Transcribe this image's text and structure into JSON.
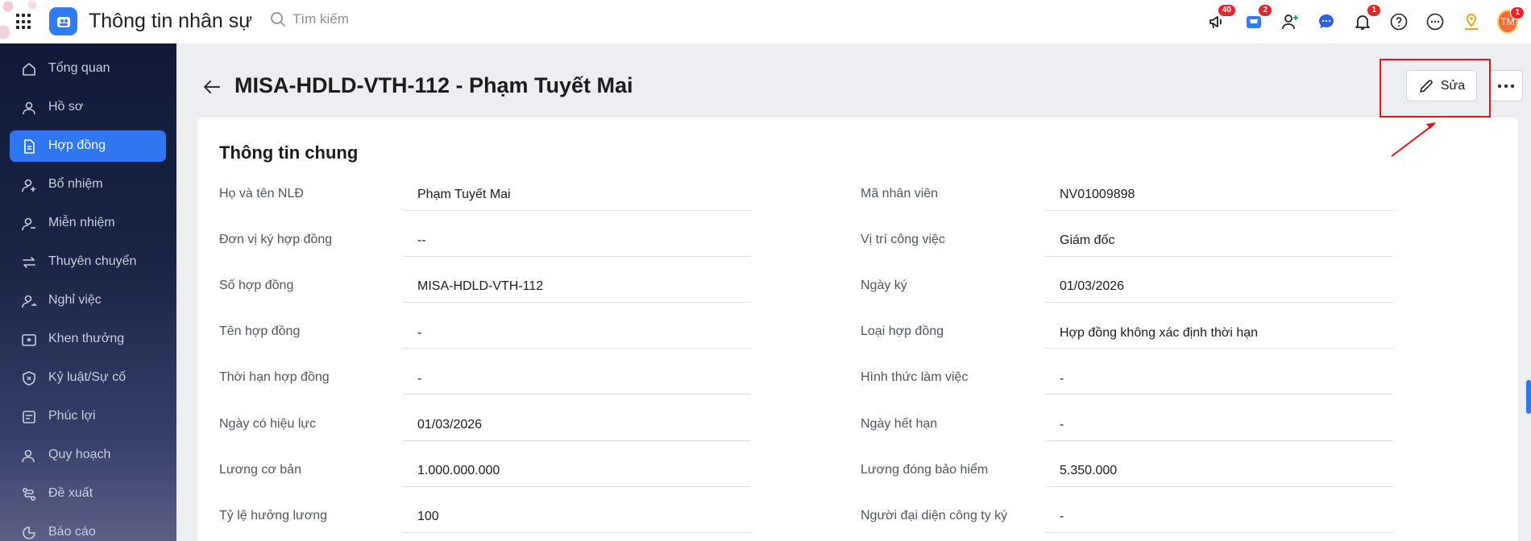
{
  "app": {
    "title": "Thông tin nhân sự"
  },
  "search": {
    "placeholder": "Tìm kiếm"
  },
  "topbar": {
    "badges": {
      "megaphone": "40",
      "cart": "2",
      "bell": "1",
      "avatar": "1"
    },
    "avatar_initials": "TM"
  },
  "sidebar": {
    "items": [
      {
        "label": "Tổng quan",
        "icon": "home-icon"
      },
      {
        "label": "Hồ sơ",
        "icon": "user-icon"
      },
      {
        "label": "Hợp đồng",
        "icon": "document-icon",
        "active": true
      },
      {
        "label": "Bổ nhiệm",
        "icon": "user-plus-icon"
      },
      {
        "label": "Miễn nhiệm",
        "icon": "user-minus-icon"
      },
      {
        "label": "Thuyên chuyển",
        "icon": "transfer-icon"
      },
      {
        "label": "Nghỉ việc",
        "icon": "user-leave-icon"
      },
      {
        "label": "Khen thưởng",
        "icon": "award-icon"
      },
      {
        "label": "Kỷ luật/Sự cố",
        "icon": "shield-icon"
      },
      {
        "label": "Phúc lợi",
        "icon": "benefit-icon"
      },
      {
        "label": "Quy hoạch",
        "icon": "planning-icon"
      },
      {
        "label": "Đề xuất",
        "icon": "proposal-icon"
      },
      {
        "label": "Báo cáo",
        "icon": "report-icon"
      }
    ]
  },
  "header": {
    "title": "MISA-HDLD-VTH-112 - Phạm Tuyết Mai",
    "edit_label": "Sửa"
  },
  "section": {
    "title": "Thông tin chung",
    "fields": [
      {
        "label": "Họ và tên NLĐ",
        "value": "Phạm Tuyết Mai"
      },
      {
        "label": "Mã nhân viên",
        "value": "NV01009898"
      },
      {
        "label": "Đơn vị ký hợp đồng",
        "value": "--"
      },
      {
        "label": "Vị trí công việc",
        "value": "Giám đốc"
      },
      {
        "label": "Số hợp đồng",
        "value": "MISA-HDLD-VTH-112"
      },
      {
        "label": "Ngày ký",
        "value": "01/03/2026"
      },
      {
        "label": "Tên hợp đồng",
        "value": "-"
      },
      {
        "label": "Loại hợp đồng",
        "value": "Hợp đồng không xác định thời hạn"
      },
      {
        "label": "Thời hạn hợp đồng",
        "value": "-"
      },
      {
        "label": "Hình thức làm việc",
        "value": "-"
      },
      {
        "label": "Ngày có hiệu lực",
        "value": "01/03/2026"
      },
      {
        "label": "Ngày hết hạn",
        "value": "-"
      },
      {
        "label": "Lương cơ bản",
        "value": "1.000.000.000"
      },
      {
        "label": "Lương đóng bảo hiểm",
        "value": "5.350.000"
      },
      {
        "label": "Tỷ lệ hưởng lương",
        "value": "100"
      },
      {
        "label": "Người đại diện công ty ký",
        "value": "-"
      }
    ]
  },
  "colors": {
    "accent": "#2f76f0",
    "sidebar_bg": "#101a37",
    "annotation": "#e5131b",
    "badge": "#e5252a"
  }
}
